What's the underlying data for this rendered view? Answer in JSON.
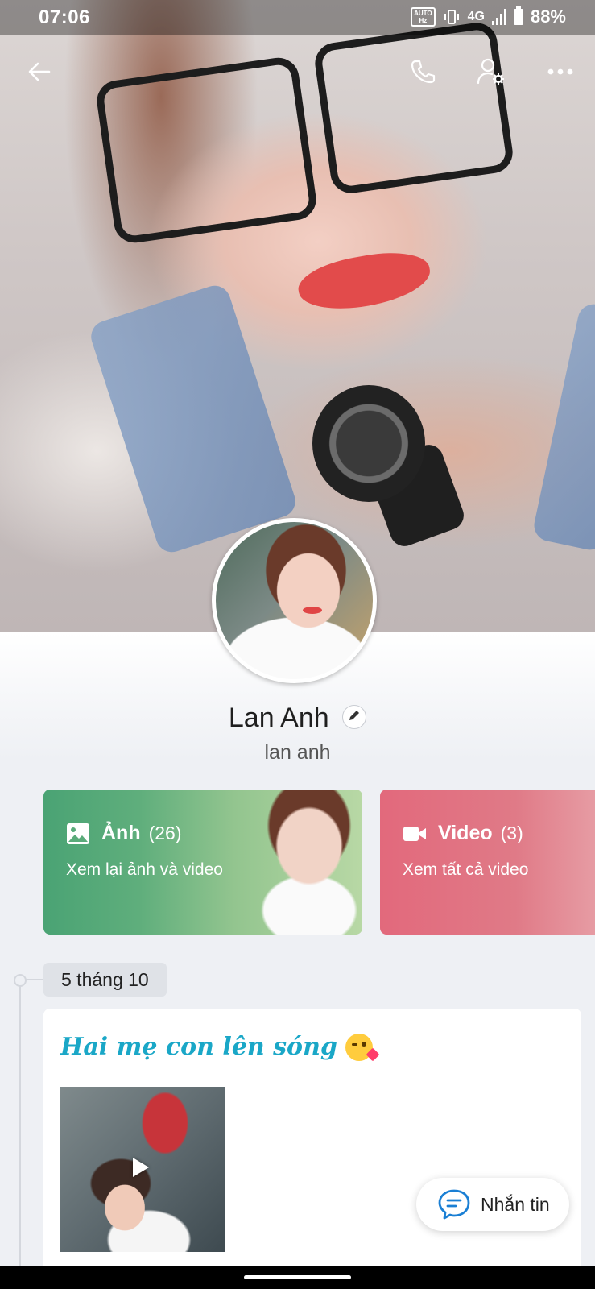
{
  "status_bar": {
    "time": "07:06",
    "hz_tag_top": "AUTO",
    "hz_tag_bottom": "Hz",
    "network": "4G",
    "battery": "88%"
  },
  "top_bar": {
    "back_icon": "arrow-left-icon",
    "call_icon": "phone-icon",
    "settings_icon": "user-settings-icon",
    "more_icon": "more-horizontal-icon"
  },
  "profile": {
    "name": "Lan Anh",
    "subname": "lan anh"
  },
  "cards": {
    "photo": {
      "title": "Ảnh",
      "count": "(26)",
      "subtitle": "Xem lại ảnh và video",
      "icon": "image-icon"
    },
    "video": {
      "title": "Video",
      "count": "(3)",
      "subtitle": "Xem tất cả video",
      "icon": "video-camera-icon"
    }
  },
  "timeline": {
    "date": "5 tháng 10",
    "post_text": "Hai mẹ con lên sóng",
    "post_emoji": "face-blowing-kiss"
  },
  "fab": {
    "label": "Nhắn tin",
    "icon": "chat-bubble-icon"
  },
  "colors": {
    "photo_card": "#4aa374",
    "video_card": "#e2697c",
    "post_text": "#1aa7c7",
    "fab_icon": "#1a7fd4"
  }
}
